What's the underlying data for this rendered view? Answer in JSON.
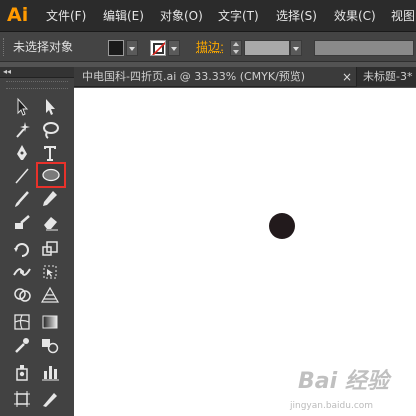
{
  "app": {
    "logo": "Ai"
  },
  "menu": {
    "items": [
      "文件(F)",
      "编辑(E)",
      "对象(O)",
      "文字(T)",
      "选择(S)",
      "效果(C)",
      "视图"
    ]
  },
  "control_bar": {
    "selection_label": "未选择对象",
    "stroke_label": "描边:",
    "fill_color": "#1a1a1a",
    "stroke_color": "none"
  },
  "panel": {
    "collapse_label": "◂◂"
  },
  "tabs": [
    {
      "label": "中电国科-四折页.ai @ 33.33% (CMYK/预览)",
      "close": "×"
    },
    {
      "label": "未标题-3*",
      "close": ""
    }
  ],
  "tools": [
    "selection-tool",
    "direct-selection-tool",
    "magic-wand-tool",
    "lasso-tool",
    "pen-tool",
    "type-tool",
    "line-segment-tool",
    "ellipse-tool",
    "paintbrush-tool",
    "pencil-tool",
    "blob-brush-tool",
    "eraser-tool",
    "rotate-tool",
    "scale-tool",
    "width-tool",
    "free-transform-tool",
    "shape-builder-tool",
    "perspective-grid-tool",
    "mesh-tool",
    "gradient-tool",
    "eyedropper-tool",
    "blend-tool",
    "symbol-sprayer-tool",
    "column-graph-tool",
    "artboard-tool",
    "slice-tool"
  ],
  "selected_tool": "ellipse-tool",
  "canvas": {
    "shape_color": "#221a1c"
  },
  "watermark": {
    "main": "Bai 经验",
    "sub": "jingyan.baidu.com"
  }
}
